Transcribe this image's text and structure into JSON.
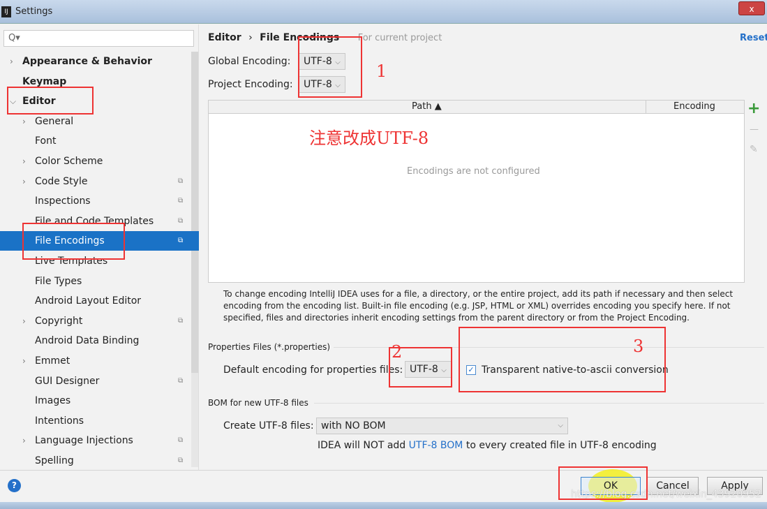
{
  "window": {
    "title": "Settings",
    "close": "x"
  },
  "search": {
    "placeholder": "Q▾"
  },
  "tree": [
    {
      "label": "Appearance & Behavior",
      "level": 0,
      "bold": true,
      "arrow": "right"
    },
    {
      "label": "Keymap",
      "level": 0,
      "bold": true
    },
    {
      "label": "Editor",
      "level": 0,
      "bold": true,
      "arrow": "down"
    },
    {
      "label": "General",
      "level": 1,
      "arrow": "right"
    },
    {
      "label": "Font",
      "level": 1
    },
    {
      "label": "Color Scheme",
      "level": 1,
      "arrow": "right"
    },
    {
      "label": "Code Style",
      "level": 1,
      "arrow": "right",
      "project": true
    },
    {
      "label": "Inspections",
      "level": 1,
      "project": true
    },
    {
      "label": "File and Code Templates",
      "level": 1,
      "project": true
    },
    {
      "label": "File Encodings",
      "level": 1,
      "project": true,
      "selected": true
    },
    {
      "label": "Live Templates",
      "level": 1
    },
    {
      "label": "File Types",
      "level": 1
    },
    {
      "label": "Android Layout Editor",
      "level": 1
    },
    {
      "label": "Copyright",
      "level": 1,
      "arrow": "right",
      "project": true
    },
    {
      "label": "Android Data Binding",
      "level": 1
    },
    {
      "label": "Emmet",
      "level": 1,
      "arrow": "right"
    },
    {
      "label": "GUI Designer",
      "level": 1,
      "project": true
    },
    {
      "label": "Images",
      "level": 1
    },
    {
      "label": "Intentions",
      "level": 1
    },
    {
      "label": "Language Injections",
      "level": 1,
      "arrow": "right",
      "project": true
    },
    {
      "label": "Spelling",
      "level": 1,
      "project": true
    }
  ],
  "breadcrumb": {
    "parent": "Editor",
    "sep": "›",
    "current": "File Encodings",
    "scope": "For current project"
  },
  "reset": "Reset",
  "global": {
    "label": "Global Encoding:",
    "value": "UTF-8"
  },
  "project": {
    "label": "Project Encoding:",
    "value": "UTF-8"
  },
  "table": {
    "columns": [
      "Path ▲",
      "Encoding"
    ],
    "empty": "Encodings are not configured"
  },
  "toolbar": {
    "add": "+",
    "remove": "—",
    "edit": "✎"
  },
  "help_text": "To change encoding IntelliJ IDEA uses for a file, a directory, or the entire project, add its path if necessary and then select encoding from the encoding list. Built-in file encoding (e.g. JSP, HTML or XML) overrides encoding you specify here. If not specified, files and directories inherit encoding settings from the parent directory or from the Project Encoding.",
  "properties": {
    "section": "Properties Files (*.properties)",
    "label": "Default encoding for properties files:",
    "value": "UTF-8",
    "checkbox_label": "Transparent native-to-ascii conversion",
    "checked": true
  },
  "bom": {
    "section": "BOM for new UTF-8 files",
    "label": "Create UTF-8 files:",
    "value": "with NO BOM",
    "note_pre": "IDEA will NOT add ",
    "note_link": "UTF-8 BOM",
    "note_post": " to every created file in UTF-8 encoding"
  },
  "buttons": {
    "ok": "OK",
    "cancel": "Cancel",
    "apply": "Apply",
    "help": "?"
  },
  "annotations": {
    "n1": "1",
    "note": "注意改成UTF-8",
    "n2": "2",
    "n3": "3"
  },
  "watermark": "https://blog.csdn.net/weixin_43920952",
  "colors": {
    "accent": "#1a72c6",
    "annotation": "#e33333",
    "link": "#2470c9"
  }
}
